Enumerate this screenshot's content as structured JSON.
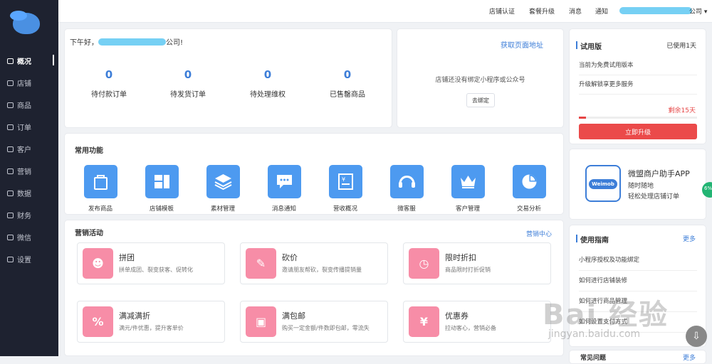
{
  "topbar": {
    "links": [
      "店铺认证",
      "套餐升级",
      "消息",
      "通知"
    ],
    "company_suffix": "公司"
  },
  "sidebar": {
    "items": [
      "概况",
      "店铺",
      "商品",
      "订单",
      "客户",
      "营销",
      "数据",
      "财务",
      "微信",
      "设置"
    ]
  },
  "greeting": {
    "prefix": "下午好，",
    "suffix": "公司!",
    "stats": [
      {
        "value": "0",
        "label": "待付款订单"
      },
      {
        "value": "0",
        "label": "待发货订单"
      },
      {
        "value": "0",
        "label": "待处理维权"
      },
      {
        "value": "0",
        "label": "已售罄商品"
      }
    ]
  },
  "bind_card": {
    "get_link": "获取页面地址",
    "message": "店铺还没有绑定小程序或公众号",
    "button": "去绑定"
  },
  "trial": {
    "title": "试用版",
    "used": "已使用1天",
    "rows": [
      "当前为免费试用版本",
      "升级解锁享更多服务"
    ],
    "remaining": "剩余15天",
    "progress": 0.06,
    "upgrade_button": "立即升级"
  },
  "app_promo": {
    "icon_text": "Weimob",
    "title": "微盟商户助手APP",
    "line1": "随时随地",
    "line2": "轻松处理店铺订单"
  },
  "common": {
    "title": "常用功能",
    "items": [
      "发布商品",
      "店铺模板",
      "素材管理",
      "消息通知",
      "营收概况",
      "微客服",
      "客户管理",
      "交易分析"
    ]
  },
  "marketing": {
    "title": "营销活动",
    "more": "营销中心",
    "items": [
      {
        "name": "拼团",
        "desc": "拼单成团、裂变获客、促转化"
      },
      {
        "name": "砍价",
        "desc": "邀请朋友帮砍，裂变传播提销量"
      },
      {
        "name": "限时折扣",
        "desc": "商品限时打折促销"
      },
      {
        "name": "满减满折",
        "desc": "满元/件优惠，提升客单价"
      },
      {
        "name": "满包邮",
        "desc": "购买一定金额/件数即包邮，零流失"
      },
      {
        "name": "优惠券",
        "desc": "拉动客心，营销必备"
      }
    ]
  },
  "guide": {
    "title": "使用指南",
    "more": "更多",
    "items": [
      "小程序授权及功能绑定",
      "如何进行店铺装修",
      "如何进行商品管理",
      "如何设置支付方式"
    ]
  },
  "faq": {
    "title": "常见问题",
    "more": "更多"
  },
  "watermark": {
    "main": "Bai 经验",
    "url": "jingyan.baidu.com"
  },
  "badge": {
    "text": "6%"
  }
}
